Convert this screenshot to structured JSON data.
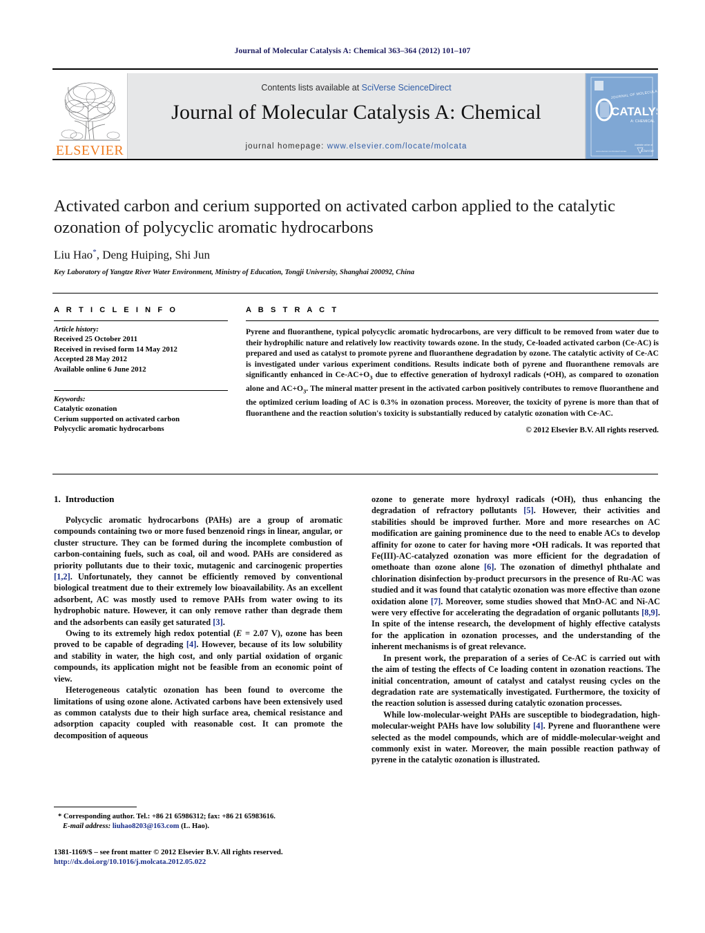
{
  "running_head": "Journal of Molecular Catalysis A: Chemical 363–364 (2012) 101–107",
  "masthead": {
    "contents_prefix": "Contents lists available at ",
    "contents_link": "SciVerse ScienceDirect",
    "journal_title": "Journal of Molecular Catalysis A: Chemical",
    "homepage_prefix": "journal homepage: ",
    "homepage_url": "www.elsevier.com/locate/molcata",
    "publisher_logo_text": "ELSEVIER",
    "cover": {
      "line1": "JOURNAL OF MOLECULAR",
      "line2": "CATALYSIS",
      "line3": "A: CHEMICAL",
      "publisher": "ELSEVIER",
      "color": "#7fa7d4"
    }
  },
  "article": {
    "title": "Activated carbon and cerium supported on activated carbon applied to the catalytic ozonation of polycyclic aromatic hydrocarbons",
    "authors": "Liu Hao",
    "authors_rest": ", Deng Huiping, Shi Jun",
    "corresponding_marker": "*",
    "affiliation": "Key Laboratory of Yangtze River Water Environment, Ministry of Education, Tongji University, Shanghai 200092, China"
  },
  "article_info": {
    "heading": "A R T I C L E    I N F O",
    "history_label": "Article history:",
    "history": [
      "Received 25 October 2011",
      "Received in revised form 14 May 2012",
      "Accepted 28 May 2012",
      "Available online 6 June 2012"
    ],
    "keywords_label": "Keywords:",
    "keywords": [
      "Catalytic ozonation",
      "Cerium supported on activated carbon",
      "Polycyclic aromatic hydrocarbons"
    ]
  },
  "abstract": {
    "heading": "A B S T R A C T",
    "text_part1": "Pyrene and fluoranthene, typical polycyclic aromatic hydrocarbons, are very difficult to be removed from water due to their hydrophilic nature and relatively low reactivity towards ozone. In the study, Ce-loaded activated carbon (Ce-AC) is prepared and used as catalyst to promote pyrene and fluoranthene degradation by ozone. The catalytic activity of Ce-AC is investigated under various experiment conditions. Results indicate both of pyrene and fluoranthene removals are significantly enhanced in Ce-AC+O",
    "sub1": "3",
    "text_part2": " due to effective generation of hydroxyl radicals (",
    "radical": "•OH",
    "text_part3": "), as compared to ozonation alone and AC+O",
    "sub2": "3",
    "text_part4": ". The mineral matter present in the activated carbon positively contributes to remove fluoranthene and the optimized cerium loading of AC is 0.3% in ozonation process. Moreover, the toxicity of pyrene is more than that of fluoranthene and the reaction solution's toxicity is substantially reduced by catalytic ozonation with Ce-AC.",
    "copyright": "© 2012 Elsevier B.V. All rights reserved."
  },
  "sections": {
    "intro_number": "1.",
    "intro_title": "Introduction"
  },
  "paragraphs": {
    "left": [
      {
        "t1": "Polycyclic aromatic hydrocarbons (PAHs) are a group of aromatic compounds containing two or more fused benzenoid rings in linear, angular, or cluster structure. They can be formed during the incomplete combustion of carbon-containing fuels, such as coal, oil and wood. PAHs are considered as priority pollutants due to their toxic, mutagenic and carcinogenic properties ",
        "ref1": "[1,2]",
        "t2": ". Unfortunately, they cannot be efficiently removed by conventional biological treatment due to their extremely low bioavailability. As an excellent adsorbent, AC was mostly used to remove PAHs from water owing to its hydrophobic nature. However, it can only remove rather than degrade them and the adsorbents can easily get saturated ",
        "ref2": "[3]",
        "t3": "."
      },
      {
        "t1": "Owing to its extremely high redox potential (",
        "ital": "E",
        "t2": " = 2.07 V), ozone has been proved to be capable of degrading ",
        "ref1": "[4]",
        "t3": ". However, because of its low solubility and stability in water, the high cost, and only partial oxidation of organic compounds, its application might not be feasible from an economic point of view."
      },
      {
        "t1": "Heterogeneous catalytic ozonation has been found to overcome the limitations of using ozone alone. Activated carbons have been extensively used as common catalysts due to their high surface area, chemical resistance and adsorption capacity coupled with reasonable cost. It can promote the decomposition of aqueous"
      }
    ],
    "right": [
      {
        "t1": "ozone to generate more hydroxyl radicals (",
        "radical": "•OH",
        "t2": "), thus enhancing the degradation of refractory pollutants ",
        "ref1": "[5]",
        "t3": ". However, their activities and stabilities should be improved further. More and more researches on AC modification are gaining prominence due to the need to enable ACs to develop affinity for ozone to cater for having more ",
        "radical2": "•OH",
        "t4": " radicals. It was reported that Fe(III)-AC-catalyzed ozonation was more efficient for the degradation of omethoate than ozone alone ",
        "ref2": "[6]",
        "t5": ". The ozonation of dimethyl phthalate and chlorination disinfection by-product precursors in the presence of Ru-AC was studied and it was found that catalytic ozonation was more effective than ozone oxidation alone ",
        "ref3": "[7]",
        "t6": ". Moreover, some studies showed that MnO-AC and Ni-AC were very effective for accelerating the degradation of organic pollutants ",
        "ref4": "[8,9]",
        "t7": ". In spite of the intense research, the development of highly effective catalysts for the application in ozonation processes, and the understanding of the inherent mechanisms is of great relevance."
      },
      {
        "t1": "In present work, the preparation of a series of Ce-AC is carried out with the aim of testing the effects of Ce loading content in ozonation reactions. The initial concentration, amount of catalyst and catalyst reusing cycles on the degradation rate are systematically investigated. Furthermore, the toxicity of the reaction solution is assessed during catalytic ozonation processes."
      },
      {
        "t1": "While low-molecular-weight PAHs are susceptible to biodegradation, high-molecular-weight PAHs have low solubility ",
        "ref1": "[4]",
        "t2": ". Pyrene and fluoranthene were selected as the model compounds, which are of middle-molecular-weight and commonly exist in water. Moreover, the main possible reaction pathway of pyrene in the catalytic ozonation is illustrated."
      }
    ]
  },
  "footnote": {
    "marker": "*",
    "corresponding": " Corresponding author. Tel.: +86 21 65986312; fax: +86 21 65983616.",
    "email_label": "E-mail address:",
    "email": "liuhao8203@163.com",
    "email_suffix": " (L. Hao)."
  },
  "footer": {
    "issn_line": "1381-1169/$ – see front matter © 2012 Elsevier B.V. All rights reserved.",
    "doi": "http://dx.doi.org/10.1016/j.molcata.2012.05.022"
  }
}
